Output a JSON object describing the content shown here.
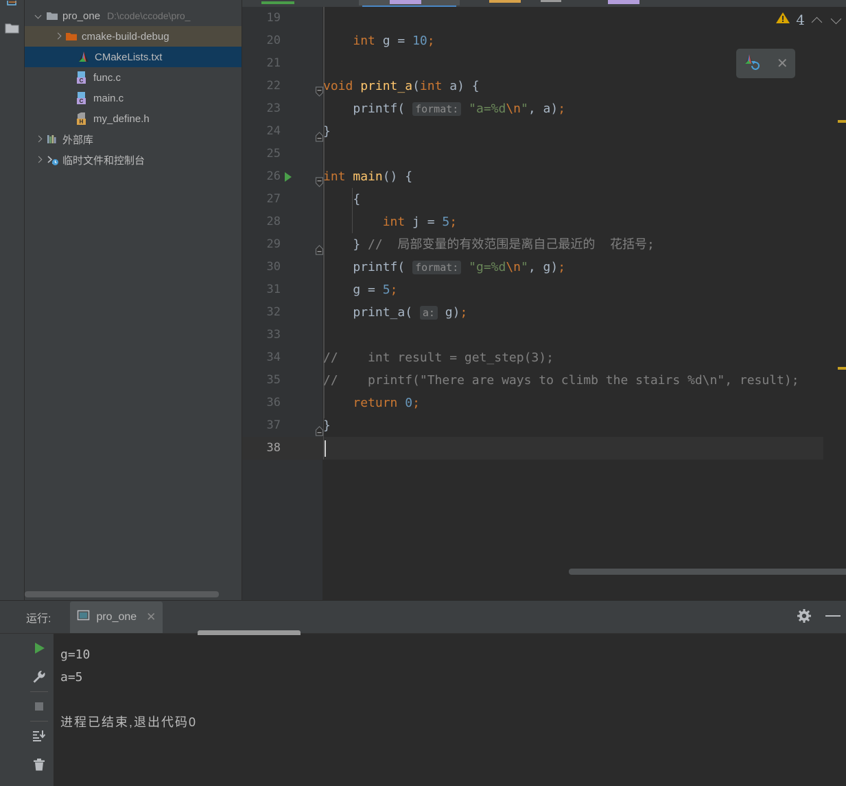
{
  "window": {
    "theme_bg": "#3c3f41",
    "editor_bg": "#2b2b2b",
    "accent": "#4a88c7"
  },
  "toolstrip": {
    "items": [
      {
        "name": "structure-icon",
        "glyph": ""
      },
      {
        "name": "project-icon",
        "glyph": ""
      }
    ]
  },
  "project_tree": {
    "nodes": [
      {
        "label": "pro_one",
        "path_hint": "D:\\code\\ccode\\pro_",
        "icon": "folder-gray",
        "arrow": "down",
        "indent": 0,
        "state": "normal"
      },
      {
        "label": "cmake-build-debug",
        "path_hint": "",
        "icon": "folder-orange",
        "arrow": "right",
        "indent": 1,
        "state": "selected-inactive"
      },
      {
        "label": "CMakeLists.txt",
        "path_hint": "",
        "icon": "cmake",
        "arrow": "none",
        "indent": 2,
        "state": "selected-active"
      },
      {
        "label": "func.c",
        "path_hint": "",
        "icon": "c-file",
        "arrow": "none",
        "indent": 2,
        "state": "normal"
      },
      {
        "label": "main.c",
        "path_hint": "",
        "icon": "c-file",
        "arrow": "none",
        "indent": 2,
        "state": "normal"
      },
      {
        "label": "my_define.h",
        "path_hint": "",
        "icon": "h-file",
        "arrow": "none",
        "indent": 2,
        "state": "normal"
      },
      {
        "label": "外部库",
        "path_hint": "",
        "icon": "library",
        "arrow": "right",
        "indent": 0,
        "state": "normal"
      },
      {
        "label": "临时文件和控制台",
        "path_hint": "",
        "icon": "console-scratch",
        "arrow": "right",
        "indent": 0,
        "state": "normal"
      }
    ]
  },
  "editor": {
    "filename_tab_active": true,
    "warnings": {
      "icon": "warning-triangle-icon",
      "count": "4"
    },
    "nav_up": "⌃",
    "nav_down": "⌄",
    "cmake_widget": {
      "reload_icon": "cmake-reload-icon",
      "close_label": "✕"
    },
    "first_visible_line": "19",
    "lines": [
      {
        "n": "19",
        "tokens": []
      },
      {
        "n": "20",
        "tokens": [
          {
            "t": "    ",
            "c": "punc"
          },
          {
            "t": "int",
            "c": "kw"
          },
          {
            "t": " g ",
            "c": "id"
          },
          {
            "t": "= ",
            "c": "id"
          },
          {
            "t": "10",
            "c": "num"
          },
          {
            "t": ";",
            "c": "semi"
          }
        ]
      },
      {
        "n": "21",
        "tokens": []
      },
      {
        "n": "22",
        "fold": "open",
        "tokens": [
          {
            "t": "void",
            "c": "kw"
          },
          {
            "t": " ",
            "c": "id"
          },
          {
            "t": "print_a",
            "c": "fn"
          },
          {
            "t": "(",
            "c": "punc"
          },
          {
            "t": "int",
            "c": "kw"
          },
          {
            "t": " a",
            "c": "id"
          },
          {
            "t": ") {",
            "c": "punc"
          }
        ]
      },
      {
        "n": "23",
        "tokens": [
          {
            "t": "    ",
            "c": "punc"
          },
          {
            "t": "printf",
            "c": "id"
          },
          {
            "t": "( ",
            "c": "punc"
          },
          {
            "t": "format:",
            "c": "hint"
          },
          {
            "t": " ",
            "c": "punc"
          },
          {
            "t": "\"a=%d",
            "c": "str"
          },
          {
            "t": "\\n",
            "c": "esc"
          },
          {
            "t": "\"",
            "c": "str"
          },
          {
            "t": ", a",
            "c": "id"
          },
          {
            "t": ")",
            "c": "punc"
          },
          {
            "t": ";",
            "c": "semi"
          }
        ]
      },
      {
        "n": "24",
        "fold": "close",
        "tokens": [
          {
            "t": "}",
            "c": "punc"
          }
        ]
      },
      {
        "n": "25",
        "tokens": []
      },
      {
        "n": "26",
        "fold": "open",
        "runmark": true,
        "tokens": [
          {
            "t": "int",
            "c": "kw"
          },
          {
            "t": " ",
            "c": "id"
          },
          {
            "t": "main",
            "c": "fn"
          },
          {
            "t": "() {",
            "c": "punc"
          }
        ]
      },
      {
        "n": "27",
        "tokens": [
          {
            "t": "    {",
            "c": "punc"
          }
        ]
      },
      {
        "n": "28",
        "tokens": [
          {
            "t": "        ",
            "c": "punc"
          },
          {
            "t": "int",
            "c": "kw"
          },
          {
            "t": " j ",
            "c": "id"
          },
          {
            "t": "= ",
            "c": "id"
          },
          {
            "t": "5",
            "c": "num"
          },
          {
            "t": ";",
            "c": "semi"
          }
        ]
      },
      {
        "n": "29",
        "fold": "close",
        "tokens": [
          {
            "t": "    }",
            "c": "punc"
          },
          {
            "t": " // ",
            "c": "cmt"
          },
          {
            "t": " 局部变量的有效范围是离自己最近的  花括号;",
            "c": "cmt"
          }
        ]
      },
      {
        "n": "30",
        "tokens": [
          {
            "t": "    ",
            "c": "punc"
          },
          {
            "t": "printf",
            "c": "id"
          },
          {
            "t": "( ",
            "c": "punc"
          },
          {
            "t": "format:",
            "c": "hint"
          },
          {
            "t": " ",
            "c": "punc"
          },
          {
            "t": "\"g=%d",
            "c": "str"
          },
          {
            "t": "\\n",
            "c": "esc"
          },
          {
            "t": "\"",
            "c": "str"
          },
          {
            "t": ", g",
            "c": "id"
          },
          {
            "t": ")",
            "c": "punc"
          },
          {
            "t": ";",
            "c": "semi"
          }
        ]
      },
      {
        "n": "31",
        "tokens": [
          {
            "t": "    g ",
            "c": "id"
          },
          {
            "t": "= ",
            "c": "id"
          },
          {
            "t": "5",
            "c": "num"
          },
          {
            "t": ";",
            "c": "semi"
          }
        ]
      },
      {
        "n": "32",
        "tokens": [
          {
            "t": "    ",
            "c": "punc"
          },
          {
            "t": "print_a",
            "c": "id"
          },
          {
            "t": "( ",
            "c": "punc"
          },
          {
            "t": "a:",
            "c": "hint"
          },
          {
            "t": " g",
            "c": "id"
          },
          {
            "t": ")",
            "c": "punc"
          },
          {
            "t": ";",
            "c": "semi"
          }
        ]
      },
      {
        "n": "33",
        "tokens": []
      },
      {
        "n": "34",
        "tokens": [
          {
            "t": "//    int result = get_step(3);",
            "c": "cmt"
          }
        ]
      },
      {
        "n": "35",
        "tokens": [
          {
            "t": "//    printf(\"There are ways to climb the stairs %d\\n\", result);",
            "c": "cmt"
          }
        ]
      },
      {
        "n": "36",
        "tokens": [
          {
            "t": "    ",
            "c": "punc"
          },
          {
            "t": "return",
            "c": "kw"
          },
          {
            "t": " ",
            "c": "id"
          },
          {
            "t": "0",
            "c": "num"
          },
          {
            "t": ";",
            "c": "semi"
          }
        ]
      },
      {
        "n": "37",
        "fold": "close",
        "tokens": [
          {
            "t": "}",
            "c": "punc"
          }
        ]
      },
      {
        "n": "38",
        "current": true,
        "tokens": []
      }
    ]
  },
  "run_window": {
    "title": "运行:",
    "tab": {
      "label": "pro_one",
      "icon": "run-config-icon",
      "close": "✕"
    },
    "header_actions": [
      {
        "name": "settings-gear-icon",
        "glyph": "gear"
      },
      {
        "name": "minimize-icon",
        "glyph": "minus"
      }
    ],
    "toolbar": [
      {
        "name": "rerun-button",
        "glyph": "play"
      },
      {
        "name": "edit-configuration-button",
        "glyph": "wrench"
      },
      {
        "name": "stop-button",
        "glyph": "stop"
      },
      {
        "name": "scroll-to-end-button",
        "glyph": "scroll-end"
      },
      {
        "name": "clear-all-button",
        "glyph": "trash"
      }
    ],
    "console_lines": [
      {
        "text": "g=10",
        "cn": false
      },
      {
        "text": "a=5",
        "cn": false
      },
      {
        "text": "",
        "cn": false
      },
      {
        "text": "进程已结束,退出代码0",
        "cn": true
      }
    ]
  }
}
